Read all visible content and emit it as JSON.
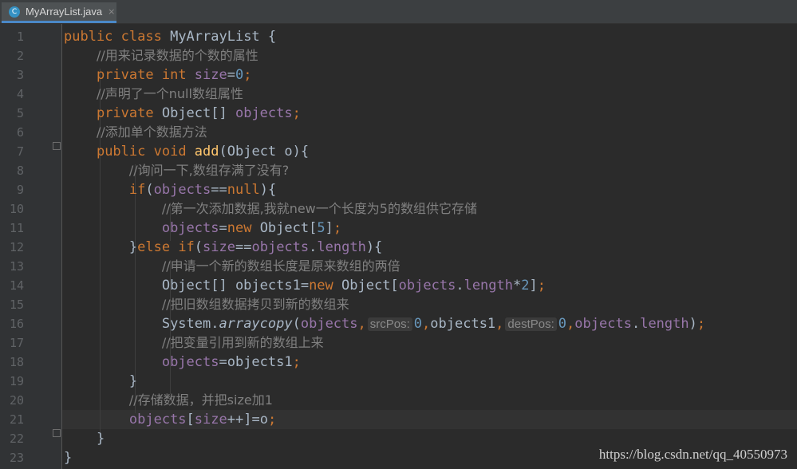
{
  "tab": {
    "icon_letter": "C",
    "label": "MyArrayList.java",
    "close": "×"
  },
  "line_numbers": [
    "1",
    "2",
    "3",
    "4",
    "5",
    "6",
    "7",
    "8",
    "9",
    "10",
    "11",
    "12",
    "13",
    "14",
    "15",
    "16",
    "17",
    "18",
    "19",
    "20",
    "21",
    "22",
    "23"
  ],
  "current_line": 21,
  "lines": [
    [
      [
        "k",
        "public "
      ],
      [
        "k",
        "class "
      ],
      [
        "p",
        "MyArrayList {"
      ]
    ],
    [
      [
        "p",
        "    "
      ],
      [
        "c",
        "//用来记录数据的个数的属性"
      ]
    ],
    [
      [
        "p",
        "    "
      ],
      [
        "k",
        "private "
      ],
      [
        "k",
        "int "
      ],
      [
        "f",
        "size"
      ],
      [
        "p",
        "="
      ],
      [
        "n",
        "0"
      ],
      [
        "s",
        ";"
      ]
    ],
    [
      [
        "p",
        "    "
      ],
      [
        "c",
        "//声明了一个null数组属性"
      ]
    ],
    [
      [
        "p",
        "    "
      ],
      [
        "k",
        "private "
      ],
      [
        "p",
        "Object[] "
      ],
      [
        "f",
        "objects"
      ],
      [
        "s",
        ";"
      ]
    ],
    [
      [
        "p",
        "    "
      ],
      [
        "c",
        "//添加单个数据方法"
      ]
    ],
    [
      [
        "p",
        "    "
      ],
      [
        "k",
        "public "
      ],
      [
        "k",
        "void "
      ],
      [
        "fn",
        "add"
      ],
      [
        "p",
        "(Object o){"
      ]
    ],
    [
      [
        "p",
        "        "
      ],
      [
        "c",
        "//询问一下,数组存满了没有?"
      ]
    ],
    [
      [
        "p",
        "        "
      ],
      [
        "k",
        "if"
      ],
      [
        "p",
        "("
      ],
      [
        "f",
        "objects"
      ],
      [
        "p",
        "=="
      ],
      [
        "k",
        "null"
      ],
      [
        "p",
        "){"
      ]
    ],
    [
      [
        "p",
        "            "
      ],
      [
        "c",
        "//第一次添加数据,我就new一个长度为5的数组供它存储"
      ]
    ],
    [
      [
        "p",
        "            "
      ],
      [
        "f",
        "objects"
      ],
      [
        "p",
        "="
      ],
      [
        "k",
        "new "
      ],
      [
        "p",
        "Object["
      ],
      [
        "n",
        "5"
      ],
      [
        "p",
        "]"
      ],
      [
        "s",
        ";"
      ]
    ],
    [
      [
        "p",
        "        "
      ],
      [
        "p",
        "}"
      ],
      [
        "k",
        "else if"
      ],
      [
        "p",
        "("
      ],
      [
        "f",
        "size"
      ],
      [
        "p",
        "=="
      ],
      [
        "f",
        "objects"
      ],
      [
        "p",
        "."
      ],
      [
        "f",
        "length"
      ],
      [
        "p",
        "){"
      ]
    ],
    [
      [
        "p",
        "            "
      ],
      [
        "c",
        "//申请一个新的数组长度是原来数组的两倍"
      ]
    ],
    [
      [
        "p",
        "            "
      ],
      [
        "p",
        "Object[] objects1="
      ],
      [
        "k",
        "new "
      ],
      [
        "p",
        "Object["
      ],
      [
        "f",
        "objects"
      ],
      [
        "p",
        "."
      ],
      [
        "f",
        "length"
      ],
      [
        "p",
        "*"
      ],
      [
        "n",
        "2"
      ],
      [
        "p",
        "]"
      ],
      [
        "s",
        ";"
      ]
    ],
    [
      [
        "p",
        "            "
      ],
      [
        "c",
        "//把旧数组数据拷贝到新的数组来"
      ]
    ],
    [
      [
        "p",
        "            "
      ],
      [
        "p",
        "System."
      ],
      [
        "i",
        "arraycopy"
      ],
      [
        "p",
        "("
      ],
      [
        "f",
        "objects"
      ],
      [
        "s",
        ","
      ],
      [
        "h",
        "srcPos:"
      ],
      [
        "n",
        "0"
      ],
      [
        "s",
        ","
      ],
      [
        "p",
        "objects1"
      ],
      [
        "s",
        ","
      ],
      [
        "h",
        "destPos:"
      ],
      [
        "n",
        "0"
      ],
      [
        "s",
        ","
      ],
      [
        "f",
        "objects"
      ],
      [
        "p",
        "."
      ],
      [
        "f",
        "length"
      ],
      [
        "p",
        ")"
      ],
      [
        "s",
        ";"
      ]
    ],
    [
      [
        "p",
        "            "
      ],
      [
        "c",
        "//把变量引用到新的数组上来"
      ]
    ],
    [
      [
        "p",
        "            "
      ],
      [
        "f",
        "objects"
      ],
      [
        "p",
        "=objects1"
      ],
      [
        "s",
        ";"
      ]
    ],
    [
      [
        "p",
        "        "
      ],
      [
        "p",
        "}"
      ]
    ],
    [
      [
        "p",
        "        "
      ],
      [
        "c",
        "//存储数据，并把size加1"
      ]
    ],
    [
      [
        "p",
        "        "
      ],
      [
        "f",
        "objects"
      ],
      [
        "p",
        "["
      ],
      [
        "f",
        "size"
      ],
      [
        "p",
        "++]=o"
      ],
      [
        "s",
        ";"
      ]
    ],
    [
      [
        "p",
        "    "
      ],
      [
        "p",
        "}"
      ]
    ],
    [
      [
        "p",
        "}"
      ]
    ]
  ],
  "watermark": "https://blog.csdn.net/qq_40550973"
}
